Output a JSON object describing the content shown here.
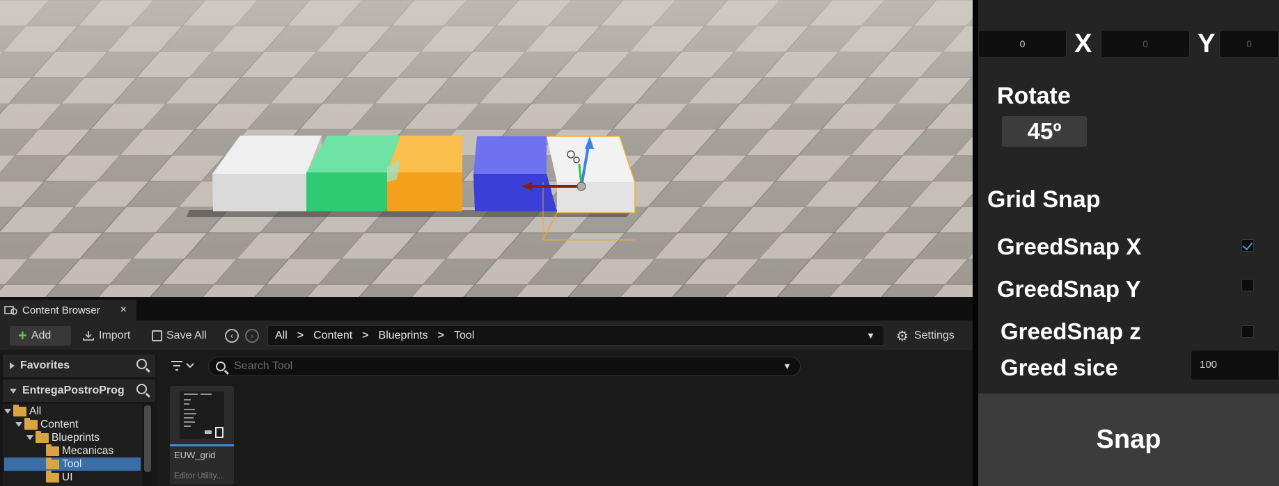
{
  "viewport": {
    "blocks": [
      {
        "name": "white-block",
        "color": "#dcdcdc"
      },
      {
        "name": "green-block",
        "color": "#4fd889"
      },
      {
        "name": "orange-block",
        "color": "#f6a623"
      },
      {
        "name": "blue-block",
        "color": "#3f48e0"
      },
      {
        "name": "selected-white-block",
        "color": "#e6e6e6",
        "selected": true
      }
    ],
    "selection_outline_color": "#f5a623"
  },
  "content_browser": {
    "tab_label": "Content Browser",
    "tab_close": "×",
    "toolbar": {
      "add_label": "Add",
      "import_label": "Import",
      "save_all_label": "Save All",
      "settings_label": "Settings"
    },
    "breadcrumbs": [
      "All",
      "Content",
      "Blueprints",
      "Tool"
    ],
    "favorites_label": "Favorites",
    "project_label": "EntregaPostroProg",
    "tree": [
      {
        "label": "All",
        "depth": 0,
        "expanded": true
      },
      {
        "label": "Content",
        "depth": 1,
        "expanded": true
      },
      {
        "label": "Blueprints",
        "depth": 2,
        "expanded": true
      },
      {
        "label": "Mecanicas",
        "depth": 3
      },
      {
        "label": "Tool",
        "depth": 3,
        "selected": true
      },
      {
        "label": "UI",
        "depth": 3
      }
    ],
    "search_placeholder": "Search Tool",
    "asset": {
      "name": "EUW_grid",
      "type": "Editor Utility..."
    }
  },
  "details_panel": {
    "offset_x_value": "0",
    "x_label": "X",
    "offset_y_value": "0",
    "y_label": "Y",
    "offset_z_value": "0",
    "rotate_label": "Rotate",
    "rotate_value": "45º",
    "grid_snap_label": "Grid Snap",
    "snap_x": {
      "label": "GreedSnap X",
      "checked": true
    },
    "snap_y": {
      "label": "GreedSnap Y",
      "checked": false
    },
    "snap_z": {
      "label": "GreedSnap z",
      "checked": false
    },
    "grid_size_label": "Greed sice",
    "grid_size_value": "100",
    "snap_button_label": "Snap"
  }
}
